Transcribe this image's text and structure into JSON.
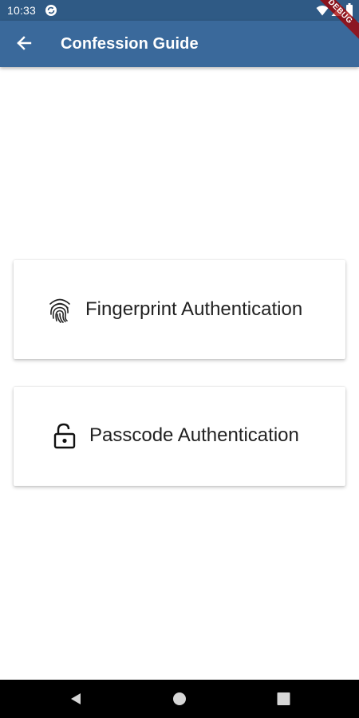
{
  "status_bar": {
    "time": "10:33",
    "icons": [
      "sync-icon",
      "wifi-icon",
      "signal-icon",
      "battery-icon"
    ]
  },
  "app_bar": {
    "title": "Confession Guide",
    "back_icon": "arrow-back-icon",
    "background_color": "#3a699b"
  },
  "debug_banner": {
    "label": "DEBUG"
  },
  "auth_options": [
    {
      "label": "Fingerprint Authentication",
      "icon": "fingerprint-icon"
    },
    {
      "label": "Passcode Authentication",
      "icon": "lock-open-icon"
    }
  ],
  "nav_bar": {
    "buttons": [
      "nav-back-icon",
      "nav-home-icon",
      "nav-recents-icon"
    ]
  },
  "colors": {
    "status_bar": "#2f5a85",
    "app_bar": "#3a699b",
    "card_text": "#222222",
    "background": "#ffffff",
    "nav_bar": "#000000"
  }
}
